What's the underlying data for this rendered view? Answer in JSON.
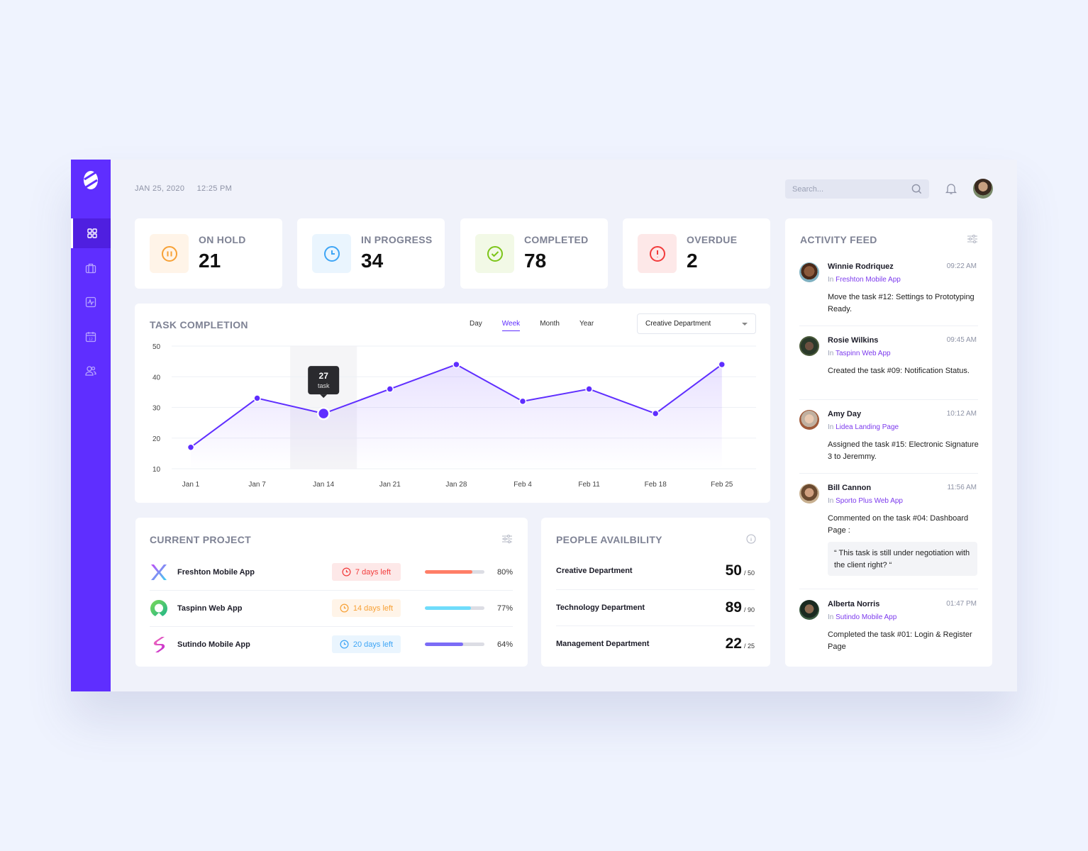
{
  "header": {
    "date": "JAN 25, 2020",
    "time": "12:25 PM",
    "search_placeholder": "Search..."
  },
  "sidebar": {
    "items": [
      {
        "name": "dashboard",
        "icon": "grid-icon",
        "active": true
      },
      {
        "name": "projects",
        "icon": "briefcase-icon",
        "active": false
      },
      {
        "name": "activity",
        "icon": "pulse-icon",
        "active": false
      },
      {
        "name": "calendar",
        "icon": "calendar-icon",
        "active": false
      },
      {
        "name": "team",
        "icon": "users-icon",
        "active": false
      }
    ]
  },
  "stats": [
    {
      "label": "ON HOLD",
      "value": "21",
      "icon": "pause-icon",
      "color": "#f7a136",
      "bg": "#fff4e8"
    },
    {
      "label": "IN PROGRESS",
      "value": "34",
      "icon": "clock-icon",
      "color": "#3ea5f5",
      "bg": "#eaf5fe"
    },
    {
      "label": "COMPLETED",
      "value": "78",
      "icon": "check-circle-icon",
      "color": "#7cc518",
      "bg": "#f2f9e6"
    },
    {
      "label": "OVERDUE",
      "value": "2",
      "icon": "alert-icon",
      "color": "#f23b3b",
      "bg": "#fde8e8"
    }
  ],
  "task_completion": {
    "title": "TASK COMPLETION",
    "tabs": [
      "Day",
      "Week",
      "Month",
      "Year"
    ],
    "active_tab": "Week",
    "department_selected": "Creative Department",
    "tooltip": {
      "value": "27",
      "unit": "task"
    }
  },
  "chart_data": {
    "type": "area",
    "title": "TASK COMPLETION",
    "xlabel": "",
    "ylabel": "",
    "categories": [
      "Jan 1",
      "Jan 7",
      "Jan 14",
      "Jan 21",
      "Jan 28",
      "Feb 4",
      "Feb 11",
      "Feb 18",
      "Feb 25"
    ],
    "series": [
      {
        "name": "task",
        "values": [
          17,
          33,
          28,
          36,
          44,
          32,
          36,
          28,
          44
        ],
        "color": "#5f2eff"
      }
    ],
    "yticks": [
      10,
      20,
      30,
      40,
      50
    ],
    "ylim": [
      10,
      50
    ],
    "grid": true,
    "highlight_index": 2,
    "highlight_label": "27 task"
  },
  "current_project": {
    "title": "CURRENT PROJECT",
    "rows": [
      {
        "name": "Freshton Mobile App",
        "deadline": "7 days left",
        "progress": 80,
        "progress_label": "80%",
        "deadline_color": "#f23b3b",
        "deadline_bg": "#fde8e8",
        "bar_color": "#ff7e67"
      },
      {
        "name": "Taspinn Web App",
        "deadline": "14 days left",
        "progress": 77,
        "progress_label": "77%",
        "deadline_color": "#f7a136",
        "deadline_bg": "#fff4e8",
        "bar_color": "#6fdcfb"
      },
      {
        "name": "Sutindo Mobile App",
        "deadline": "20 days left",
        "progress": 64,
        "progress_label": "64%",
        "deadline_color": "#3ea5f5",
        "deadline_bg": "#eaf5fe",
        "bar_color": "#7b6cf6"
      }
    ]
  },
  "people": {
    "title": "PEOPLE AVAILBILITY",
    "rows": [
      {
        "name": "Creative Department",
        "available": "50",
        "total": "/ 50"
      },
      {
        "name": "Technology Department",
        "available": "89",
        "total": "/ 90"
      },
      {
        "name": "Management Department",
        "available": "22",
        "total": "/ 25"
      }
    ]
  },
  "activity_feed": {
    "title": "ACTIVITY FEED",
    "in_label": "In",
    "items": [
      {
        "name": "Winnie Rodriquez",
        "time": "09:22 AM",
        "project": "Freshton Mobile App",
        "text": "Move the task #12: Settings to Prototyping Ready."
      },
      {
        "name": "Rosie Wilkins",
        "time": "09:45 AM",
        "project": "Taspinn Web App",
        "text": "Created the task #09: Notification Status."
      },
      {
        "name": "Amy Day",
        "time": "10:12 AM",
        "project": "Lidea Landing Page",
        "text": "Assigned the task #15: Electronic Signature 3 to Jeremmy."
      },
      {
        "name": "Bill Cannon",
        "time": "11:56 AM",
        "project": "Sporto Plus Web App",
        "text": "Commented on the task #04: Dashboard Page :",
        "quote": "“ This task is still under negotiation with the client right? “"
      },
      {
        "name": "Alberta Norris",
        "time": "01:47 PM",
        "project": "Sutindo Mobile App",
        "text": "Completed the task #01: Login & Register Page"
      }
    ]
  }
}
